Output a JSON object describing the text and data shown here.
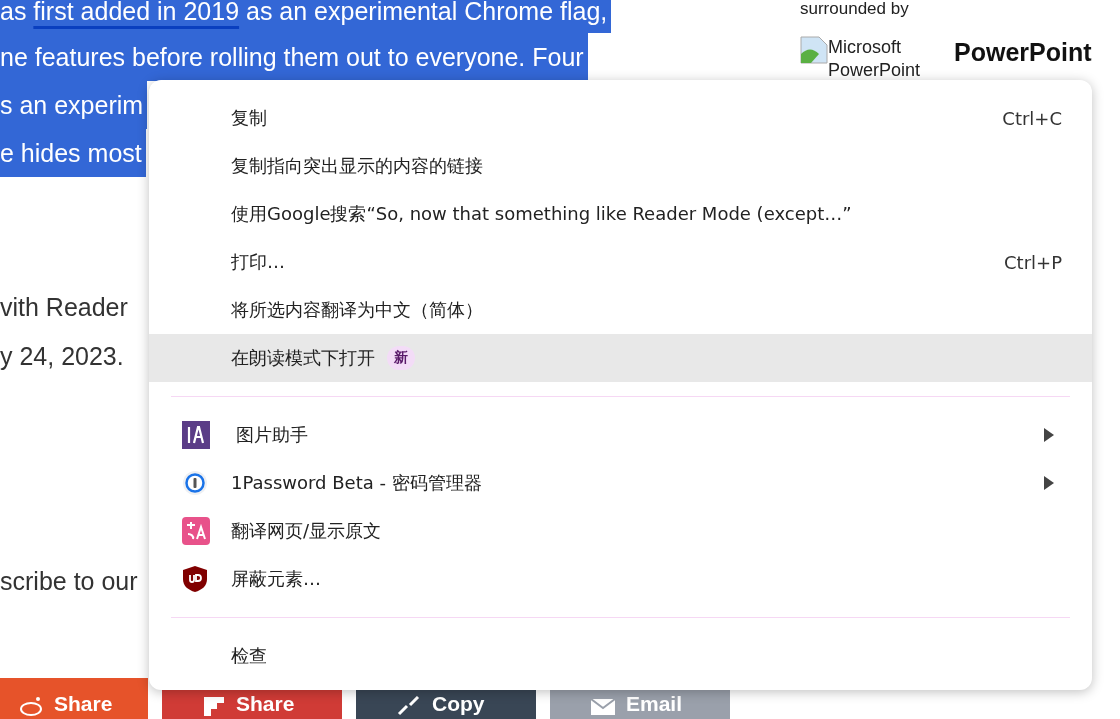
{
  "article": {
    "selected_lines": [
      {
        "parts": [
          {
            "text": "as ",
            "link": false
          },
          {
            "text": "first added in 2019",
            "link": true
          },
          {
            "text": " as an experimental Chrome flag,",
            "link": false
          }
        ]
      },
      {
        "parts": [
          {
            "text": "ne features before rolling them out to everyone. Four",
            "link": false
          }
        ]
      },
      {
        "parts": [
          {
            "text": "s an experim",
            "link": false
          }
        ]
      },
      {
        "parts": [
          {
            "text": "e hides most",
            "link": false
          }
        ]
      }
    ],
    "lines": [
      "vith Reader",
      "y 24, 2023."
    ],
    "subscribe": "scribe to our"
  },
  "sidebar": {
    "caption": "surrounded by",
    "image_alt": [
      "Microsoft",
      "PowerPoint"
    ],
    "heading": "PowerPoint"
  },
  "share_buttons": [
    {
      "label": "Share",
      "color": "#e6532a"
    },
    {
      "label": "Share",
      "color": "#d03b36"
    },
    {
      "label": "Copy",
      "color": "#394655"
    },
    {
      "label": "Email",
      "color": "#9aa0ab"
    }
  ],
  "context_menu": {
    "groups": [
      [
        {
          "label": "复制",
          "shortcut": "Ctrl+C",
          "selected": false
        },
        {
          "label": "复制指向突出显示的内容的链接",
          "selected": false
        },
        {
          "label": "使用Google搜索“So, now that something like Reader Mode (except…”",
          "selected": false
        },
        {
          "label": "打印…",
          "shortcut": "Ctrl+P",
          "selected": false
        },
        {
          "label": "将所选内容翻译为中文（简体）",
          "selected": false
        },
        {
          "label": "在朗读模式下打开",
          "badge": "新",
          "selected": true
        }
      ],
      [
        {
          "label": "图片助手",
          "submenu": true,
          "selected": false
        },
        {
          "label": "1Password Beta - 密码管理器",
          "submenu": true,
          "selected": false
        },
        {
          "label": "翻译网页/显示原文",
          "submenu": false,
          "selected": false
        },
        {
          "label": "屏蔽元素…",
          "submenu": false,
          "selected": false
        }
      ],
      [
        {
          "label": "检查",
          "selected": false
        }
      ]
    ]
  }
}
